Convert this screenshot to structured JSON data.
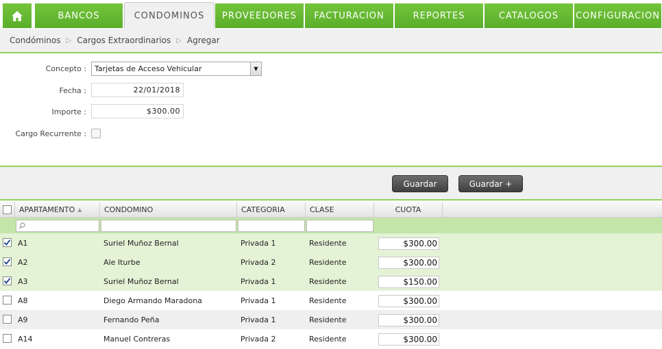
{
  "nav": {
    "home_icon": "home-icon",
    "tabs": [
      {
        "label": "BANCOS",
        "active": false
      },
      {
        "label": "CONDOMINOS",
        "active": true
      },
      {
        "label": "PROVEEDORES",
        "active": false
      },
      {
        "label": "FACTURACION",
        "active": false
      },
      {
        "label": "REPORTES",
        "active": false
      },
      {
        "label": "CATALOGOS",
        "active": false
      },
      {
        "label": "CONFIGURACION",
        "active": false
      }
    ]
  },
  "breadcrumb": [
    "Condóminos",
    "Cargos Extraordinarios",
    "Agregar"
  ],
  "form": {
    "concepto_label": "Concepto :",
    "concepto_value": "Tarjetas de Acceso Vehicular",
    "fecha_label": "Fecha :",
    "fecha_value": "22/01/2018",
    "importe_label": "Importe :",
    "importe_value": "$300.00",
    "recurrente_label": "Cargo Recurrente :",
    "recurrente_checked": false
  },
  "actions": {
    "guardar": "Guardar",
    "guardar_plus": "Guardar +"
  },
  "grid": {
    "columns": [
      "APARTAMENTO",
      "CONDOMINO",
      "CATEGORIA",
      "CLASE",
      "CUOTA"
    ],
    "sort_indicator": "▲",
    "rows": [
      {
        "checked": true,
        "apartamento": "A1",
        "condomino": "Suriel Muñoz Bernal",
        "categoria": "Privada 1",
        "clase": "Residente",
        "cuota": "$300.00"
      },
      {
        "checked": true,
        "apartamento": "A2",
        "condomino": "Ale Iturbe",
        "categoria": "Privada 2",
        "clase": "Residente",
        "cuota": "$300.00"
      },
      {
        "checked": true,
        "apartamento": "A3",
        "condomino": "Suriel Muñoz Bernal",
        "categoria": "Privada 1",
        "clase": "Residente",
        "cuota": "$150.00"
      },
      {
        "checked": false,
        "apartamento": "A8",
        "condomino": "Diego Armando Maradona",
        "categoria": "Privada 1",
        "clase": "Residente",
        "cuota": "$300.00"
      },
      {
        "checked": false,
        "apartamento": "A9",
        "condomino": "Fernando Peña",
        "categoria": "Privada 1",
        "clase": "Residente",
        "cuota": "$300.00"
      },
      {
        "checked": false,
        "apartamento": "A14",
        "condomino": "Manuel Contreras",
        "categoria": "Privada 2",
        "clase": "Residente",
        "cuota": "$300.00"
      }
    ]
  },
  "colors": {
    "nav_green": "#5aae2a",
    "selected_row": "#e4f2d6",
    "filter_row": "#c4e5a8"
  }
}
